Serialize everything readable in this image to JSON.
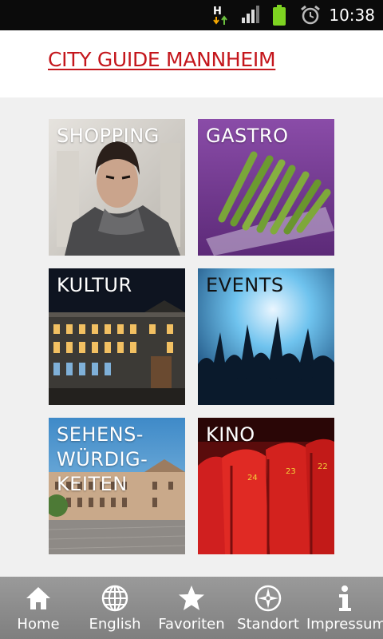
{
  "statusbar": {
    "network_label": "H",
    "time": "10:38",
    "icons": [
      "network-h-icon",
      "signal-icon",
      "battery-icon",
      "alarm-icon"
    ]
  },
  "header": {
    "title": "CITY GUIDE MANNHEIM"
  },
  "colors": {
    "brand_red": "#c4161c",
    "status_bar": "#0b0b0b",
    "nav_bar": "#8c8c8c",
    "background": "#f0f0f0"
  },
  "tiles": [
    {
      "label": "SHOPPING",
      "image": "fashion-model-photo"
    },
    {
      "label": "GASTRO",
      "image": "asparagus-photo"
    },
    {
      "label": "KULTUR",
      "image": "palace-night-photo"
    },
    {
      "label": "EVENTS",
      "image": "concert-crowd-photo"
    },
    {
      "label": "SEHENS-\nWÜRDIG-\nKEITEN",
      "image": "palace-square-photo"
    },
    {
      "label": "KINO",
      "image": "cinema-seats-photo"
    }
  ],
  "nav": [
    {
      "label": "Home",
      "icon": "home-icon"
    },
    {
      "label": "English",
      "icon": "globe-icon"
    },
    {
      "label": "Favoriten",
      "icon": "star-icon"
    },
    {
      "label": "Standort",
      "icon": "compass-icon"
    },
    {
      "label": "Impressum",
      "icon": "info-icon"
    }
  ]
}
